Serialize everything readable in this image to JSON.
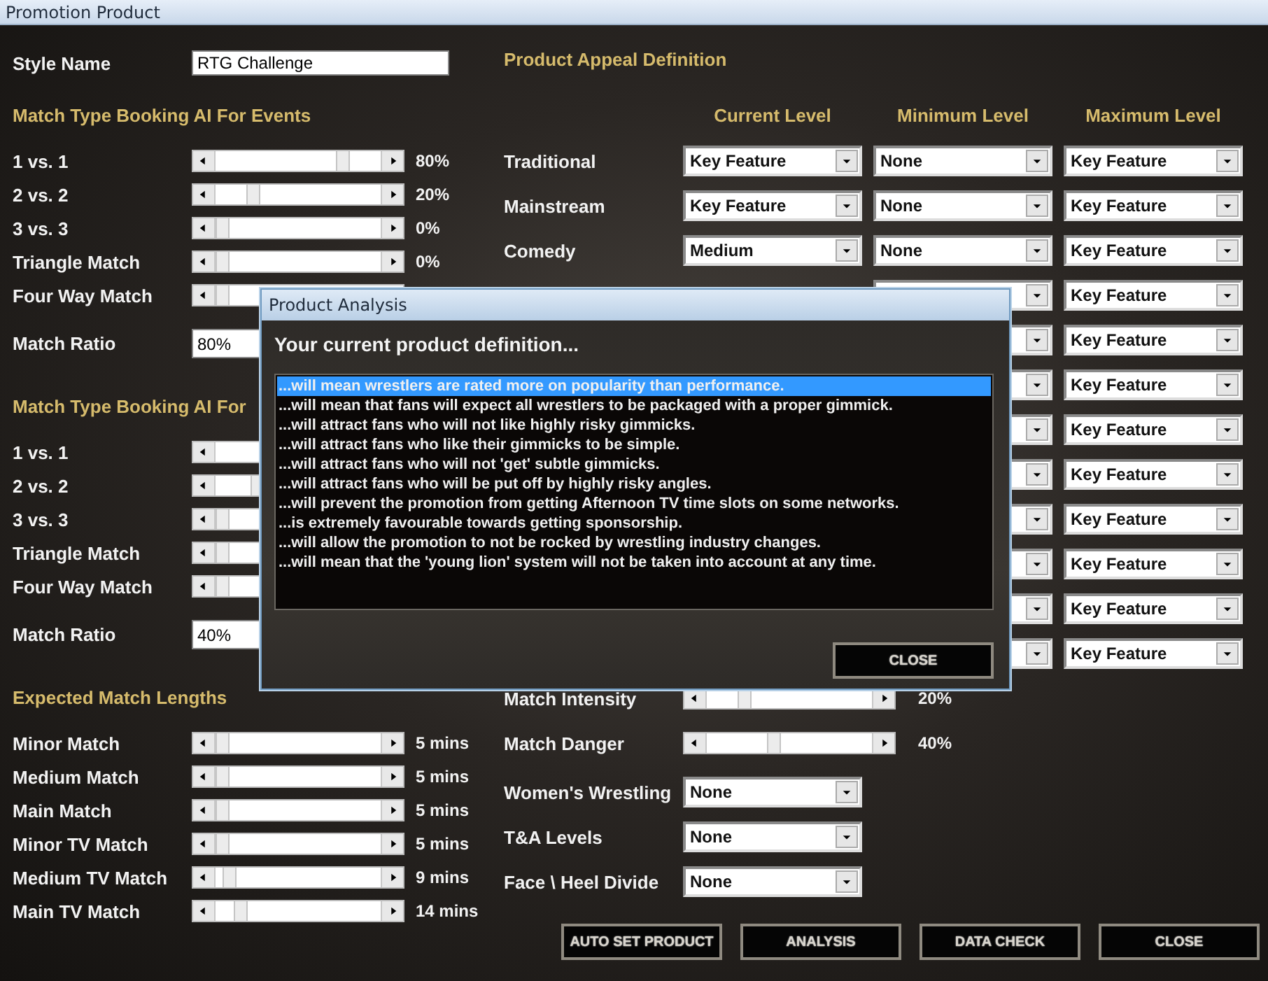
{
  "window": {
    "title": "Promotion Product"
  },
  "style_name": {
    "label": "Style Name",
    "value": "RTG Challenge"
  },
  "event_booking": {
    "title": "Match Type Booking AI For Events",
    "sliders": [
      {
        "label": "1 vs. 1",
        "level": 0.8,
        "reading": "80%"
      },
      {
        "label": "2 vs. 2",
        "level": 0.2,
        "reading": "20%"
      },
      {
        "label": "3 vs. 3",
        "level": 0,
        "reading": "0%"
      },
      {
        "label": "Triangle Match",
        "level": 0,
        "reading": "0%"
      },
      {
        "label": "Four Way Match",
        "level": 0
      }
    ],
    "ratio": {
      "label": "Match Ratio",
      "value": "80%"
    }
  },
  "tv_booking": {
    "title": "Match Type Booking AI For",
    "sliders": [
      {
        "label": "1 vs. 1"
      },
      {
        "label": "2 vs. 2",
        "level": 0.2
      },
      {
        "label": "3 vs. 3",
        "level": 0
      },
      {
        "label": "Triangle Match",
        "level": 0
      },
      {
        "label": "Four Way Match",
        "level": 0
      }
    ],
    "ratio": {
      "label": "Match Ratio",
      "value": "40%"
    }
  },
  "match_lengths": {
    "title": "Expected Match Lengths",
    "sliders": [
      {
        "label": "Minor Match",
        "level": 0,
        "reading": "5 mins"
      },
      {
        "label": "Medium Match",
        "level": 0,
        "reading": "5 mins"
      },
      {
        "label": "Main Match",
        "level": 0,
        "reading": "5 mins"
      },
      {
        "label": "Minor TV Match",
        "level": 0,
        "reading": "5 mins"
      },
      {
        "label": "Medium TV Match",
        "level": 0.05,
        "reading": "9 mins"
      },
      {
        "label": "Main TV Match",
        "level": 0.12,
        "reading": "14 mins"
      }
    ]
  },
  "appeal": {
    "title": "Product Appeal Definition",
    "columns": [
      "Current Level",
      "Minimum Level",
      "Maximum Level"
    ],
    "rows": [
      {
        "label": "Traditional",
        "current": "Key Feature",
        "minimum": "None",
        "maximum": "Key Feature"
      },
      {
        "label": "Mainstream",
        "current": "Key Feature",
        "minimum": "None",
        "maximum": "Key Feature"
      },
      {
        "label": "Comedy",
        "current": "Medium",
        "minimum": "None",
        "maximum": "Key Feature"
      },
      {
        "maximum": "Key Feature"
      },
      {
        "maximum": "Key Feature"
      },
      {
        "maximum": "Key Feature"
      },
      {
        "maximum": "Key Feature"
      },
      {
        "maximum": "Key Feature"
      },
      {
        "maximum": "Key Feature"
      },
      {
        "maximum": "Key Feature"
      },
      {
        "maximum": "Key Feature"
      },
      {
        "maximum": "Key Feature"
      }
    ]
  },
  "intensity": [
    {
      "label": "Match Intensity",
      "level": 0.2,
      "reading": "20%"
    },
    {
      "label": "Match Danger",
      "level": 0.4,
      "reading": "40%"
    }
  ],
  "settings": [
    {
      "label": "Women's Wrestling",
      "value": "None"
    },
    {
      "label": "T&A Levels",
      "value": "None"
    },
    {
      "label": "Face \\ Heel Divide",
      "value": "None"
    }
  ],
  "buttons": [
    "AUTO SET PRODUCT",
    "ANALYSIS",
    "DATA CHECK",
    "CLOSE"
  ],
  "dialog": {
    "title": "Product Analysis",
    "heading": "Your current product definition...",
    "items": [
      {
        "text": "...will mean wrestlers are rated more on popularity than performance.",
        "selected": true
      },
      {
        "text": "...will mean that fans will expect all wrestlers to be packaged with a proper gimmick.",
        "selected": false
      },
      {
        "text": "...will attract fans who will not like highly risky gimmicks.",
        "selected": false
      },
      {
        "text": "...will attract fans who like their gimmicks to be simple.",
        "selected": false
      },
      {
        "text": "...will attract fans who will not 'get' subtle gimmicks.",
        "selected": false
      },
      {
        "text": "...will attract fans who will be put off by highly risky angles.",
        "selected": false
      },
      {
        "text": "...will prevent the promotion from getting Afternoon TV time slots on some networks.",
        "selected": false
      },
      {
        "text": "...is extremely favourable towards getting sponsorship.",
        "selected": false
      },
      {
        "text": "...will allow the promotion to not be rocked by wrestling industry changes.",
        "selected": false
      },
      {
        "text": "...will mean that the 'young lion' system will not be taken into account at any time.",
        "selected": false
      }
    ],
    "button": "CLOSE"
  }
}
